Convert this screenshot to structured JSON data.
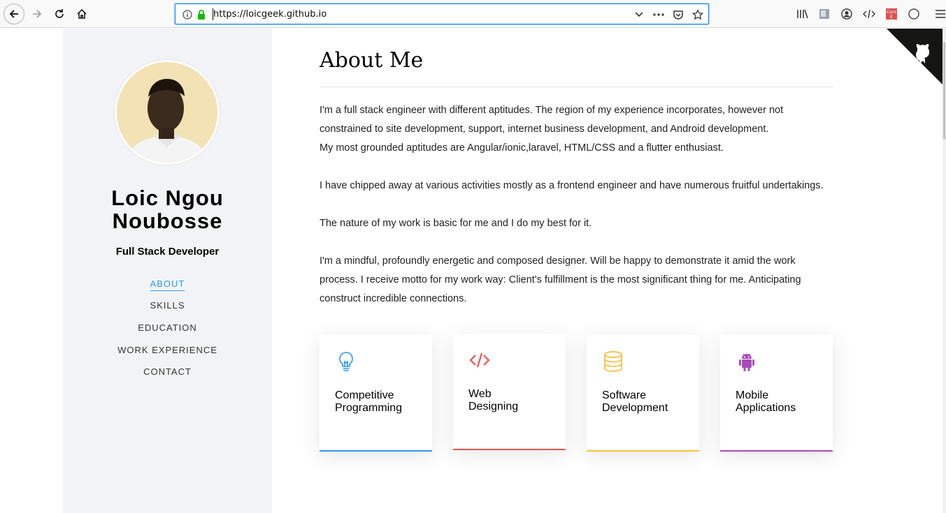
{
  "browser": {
    "url": "https://loicgeek.github.io",
    "extension_badge": "Cors E"
  },
  "profile": {
    "name_line1": "Loic Ngou",
    "name_line2": "Noubosse",
    "role": "Full Stack Developer"
  },
  "nav": {
    "items": [
      {
        "label": "ABOUT",
        "active": true
      },
      {
        "label": "SKILLS",
        "active": false
      },
      {
        "label": "EDUCATION",
        "active": false
      },
      {
        "label": "WORK EXPERIENCE",
        "active": false
      },
      {
        "label": "CONTACT",
        "active": false
      }
    ]
  },
  "about": {
    "title": "About Me",
    "paragraphs": [
      "I'm a full stack engineer with different aptitudes. The region of my experience incorporates, however not constrained to site development, support, internet business development, and Android development.",
      "My most grounded aptitudes are Angular/ionic,laravel, HTML/CSS and a flutter enthusiast.",
      "I have chipped away at various activities mostly as a frontend engineer and have numerous fruitful undertakings.",
      "The nature of my work is basic for me and I do my best for it.",
      "I'm a mindful, profoundly energetic and composed designer. Will be happy to demonstrate it amid the work process. I receive motto for my work way: Client's fulfillment is the most significant thing for me. Anticipating construct incredible connections."
    ]
  },
  "cards": [
    {
      "line1": "Competitive",
      "line2": "Programming",
      "icon": "lightbulb-icon",
      "color": "#2c98f0"
    },
    {
      "line1": "Web",
      "line2": "Designing",
      "icon": "code-icon",
      "color": "#ec5453"
    },
    {
      "line1": "Software",
      "line2": "Development",
      "icon": "database-icon",
      "color": "#f9bf3f"
    },
    {
      "line1": "Mobile",
      "line2": "Applications",
      "icon": "android-icon",
      "color": "#a84cb8"
    }
  ],
  "colors": {
    "accent": "#2c98f0",
    "sidebar_bg": "#f2f3f7"
  }
}
